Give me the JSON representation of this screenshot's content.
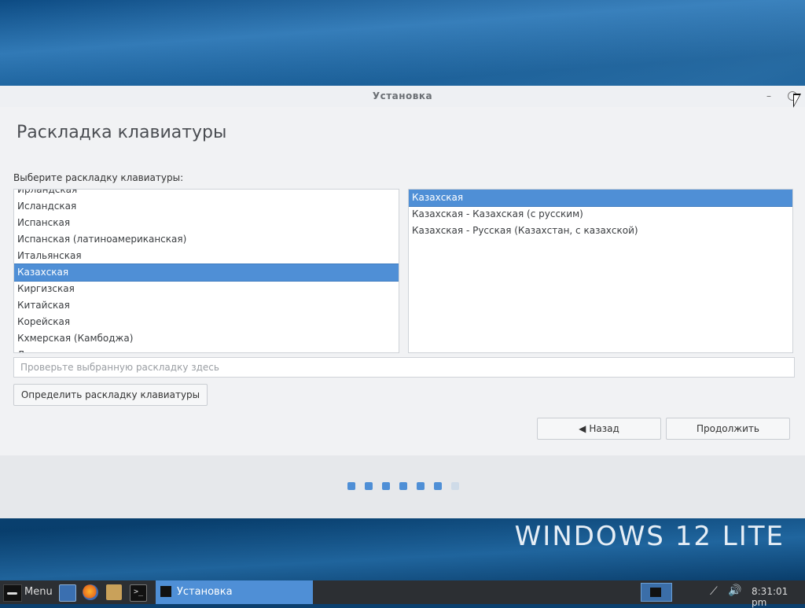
{
  "desktop": {
    "brand_text": "WINDOWS 12 LITE"
  },
  "window": {
    "title": "Установка",
    "minimize_glyph": "–"
  },
  "page": {
    "heading": "Раскладка клавиатуры",
    "prompt": "Выберите раскладку клавиатуры:"
  },
  "layouts": {
    "items": [
      {
        "label": "Ирландская",
        "selected": false
      },
      {
        "label": "Исландская",
        "selected": false
      },
      {
        "label": "Испанская",
        "selected": false
      },
      {
        "label": "Испанская (латиноамериканская)",
        "selected": false
      },
      {
        "label": "Итальянская",
        "selected": false
      },
      {
        "label": "Казахская",
        "selected": true
      },
      {
        "label": "Киргизская",
        "selected": false
      },
      {
        "label": "Китайская",
        "selected": false
      },
      {
        "label": "Корейская",
        "selected": false
      },
      {
        "label": "Кхмерская (Камбоджа)",
        "selected": false
      },
      {
        "label": "Лаосская",
        "selected": false
      }
    ]
  },
  "variants": {
    "items": [
      {
        "label": "Казахская",
        "selected": true
      },
      {
        "label": "Казахская - Казахская (с русским)",
        "selected": false
      },
      {
        "label": "Казахская - Русская (Казахстан, с казахской)",
        "selected": false
      }
    ]
  },
  "test_field": {
    "value": "",
    "placeholder": "Проверьте выбранную раскладку здесь"
  },
  "buttons": {
    "detect_label": "Определить раскладку клавиатуры",
    "back_label": "Назад",
    "next_label": "Продолжить"
  },
  "progress": {
    "total_steps": 7,
    "current_step": 6
  },
  "taskbar": {
    "menu_label": "Menu",
    "terminal_glyph": ">_",
    "active_task_label": "Установка",
    "clock": "8:31:01 pm",
    "network_glyph": "⟋",
    "volume_glyph": "🔊"
  },
  "colors": {
    "accent": "#4f8fd6",
    "taskbar": "#2c2f33"
  }
}
